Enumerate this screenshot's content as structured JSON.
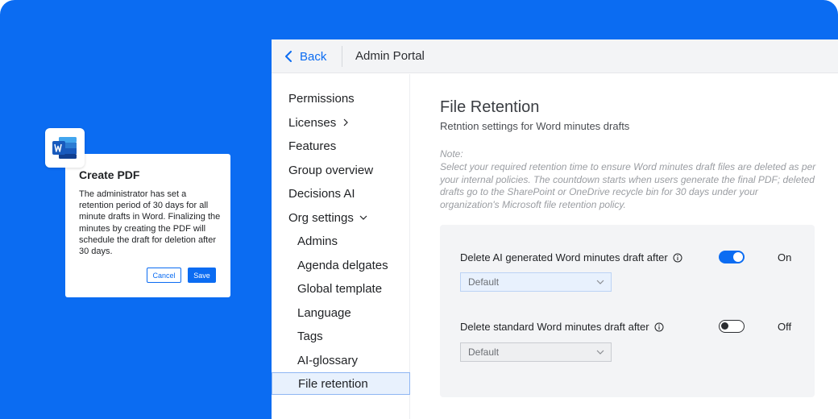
{
  "colors": {
    "accent": "#0b6cf2",
    "background": "#0b6cf2"
  },
  "header": {
    "back_label": "Back",
    "title": "Admin Portal"
  },
  "sidebar": {
    "items": [
      {
        "label": "Permissions"
      },
      {
        "label": "Licenses"
      },
      {
        "label": "Features"
      },
      {
        "label": "Group overview"
      },
      {
        "label": "Decisions AI"
      },
      {
        "label": "Org settings"
      },
      {
        "label": "Admins"
      },
      {
        "label": "Agenda delgates"
      },
      {
        "label": "Global template"
      },
      {
        "label": "Language"
      },
      {
        "label": "Tags"
      },
      {
        "label": "AI-glossary"
      },
      {
        "label": "File retention"
      }
    ]
  },
  "main": {
    "title": "File Retention",
    "subtitle": "Retntion settings for Word minutes drafts",
    "note_label": "Note:",
    "note_text": "Select your required retention time to ensure Word minutes draft files are deleted as per your internal policies. The countdown starts when users generate the final PDF; deleted drafts go to the SharePoint or OneDrive recycle bin for 30 days under your organization's Microsoft file retention policy.",
    "settings": [
      {
        "label": "Delete AI generated Word minutes draft after",
        "enabled": true,
        "state_label": "On",
        "select_value": "Default"
      },
      {
        "label": "Delete standard Word minutes draft after",
        "enabled": false,
        "state_label": "Off",
        "select_value": "Default"
      }
    ]
  },
  "dialog": {
    "app_icon": "word-icon",
    "title": "Create PDF",
    "body": "The administrator has set a retention period of 30 days for all minute drafts in Word. Finalizing the minutes by creating the PDF will schedule the draft for deletion after 30 days.",
    "cancel_label": "Cancel",
    "save_label": "Save"
  }
}
